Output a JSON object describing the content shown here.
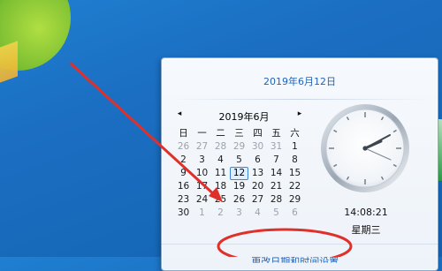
{
  "popup": {
    "header_date": "2019年6月12日",
    "month_label": "2019年6月",
    "prev_icon": "◂",
    "next_icon": "▸",
    "weekdays": [
      "日",
      "一",
      "二",
      "三",
      "四",
      "五",
      "六"
    ],
    "weeks": [
      [
        {
          "d": "26",
          "o": true
        },
        {
          "d": "27",
          "o": true
        },
        {
          "d": "28",
          "o": true
        },
        {
          "d": "29",
          "o": true
        },
        {
          "d": "30",
          "o": true
        },
        {
          "d": "31",
          "o": true
        },
        {
          "d": "1",
          "o": false
        }
      ],
      [
        {
          "d": "2",
          "o": false
        },
        {
          "d": "3",
          "o": false
        },
        {
          "d": "4",
          "o": false
        },
        {
          "d": "5",
          "o": false
        },
        {
          "d": "6",
          "o": false
        },
        {
          "d": "7",
          "o": false
        },
        {
          "d": "8",
          "o": false
        }
      ],
      [
        {
          "d": "9",
          "o": false
        },
        {
          "d": "10",
          "o": false
        },
        {
          "d": "11",
          "o": false
        },
        {
          "d": "12",
          "o": false,
          "today": true
        },
        {
          "d": "13",
          "o": false
        },
        {
          "d": "14",
          "o": false
        },
        {
          "d": "15",
          "o": false
        }
      ],
      [
        {
          "d": "16",
          "o": false
        },
        {
          "d": "17",
          "o": false
        },
        {
          "d": "18",
          "o": false
        },
        {
          "d": "19",
          "o": false
        },
        {
          "d": "20",
          "o": false
        },
        {
          "d": "21",
          "o": false
        },
        {
          "d": "22",
          "o": false
        }
      ],
      [
        {
          "d": "23",
          "o": false
        },
        {
          "d": "24",
          "o": false
        },
        {
          "d": "25",
          "o": false
        },
        {
          "d": "26",
          "o": false
        },
        {
          "d": "27",
          "o": false
        },
        {
          "d": "28",
          "o": false
        },
        {
          "d": "29",
          "o": false
        }
      ],
      [
        {
          "d": "30",
          "o": false
        },
        {
          "d": "1",
          "o": true
        },
        {
          "d": "2",
          "o": true
        },
        {
          "d": "3",
          "o": true
        },
        {
          "d": "4",
          "o": true
        },
        {
          "d": "5",
          "o": true
        },
        {
          "d": "6",
          "o": true
        }
      ]
    ],
    "time": "14:08:21",
    "weekday_label": "星期三",
    "footer_link": "更改日期和时间设置..."
  },
  "colors": {
    "annotation_red": "#e0302a",
    "link_blue": "#1f63b9"
  },
  "icons": {
    "clock": "analog-clock-icon"
  }
}
